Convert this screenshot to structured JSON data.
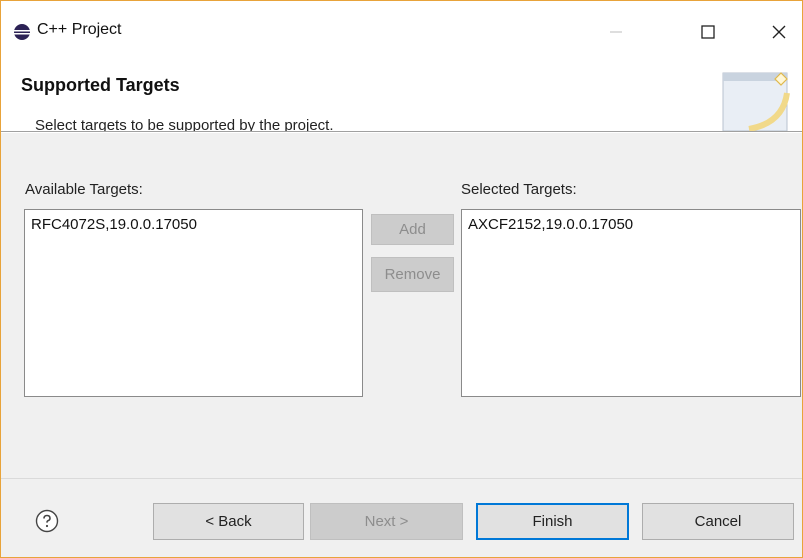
{
  "window": {
    "title": "C++ Project",
    "controls": {
      "minimize": "—",
      "maximize": "☐",
      "close": "✕"
    }
  },
  "header": {
    "title": "Supported Targets",
    "description": "Select targets to be supported by the project."
  },
  "available": {
    "label": "Available Targets:",
    "items": [
      "RFC4072S,19.0.0.17050"
    ]
  },
  "selected": {
    "label": "Selected Targets:",
    "items": [
      "AXCF2152,19.0.0.17050"
    ]
  },
  "actions": {
    "add": "Add",
    "remove": "Remove"
  },
  "footer": {
    "help_icon": "question-circle-icon",
    "back": "< Back",
    "next": "Next >",
    "finish": "Finish",
    "cancel": "Cancel"
  },
  "colors": {
    "accent": "#0078d7",
    "window_border": "#e8a33a",
    "disabled_button": "#cccccc"
  }
}
